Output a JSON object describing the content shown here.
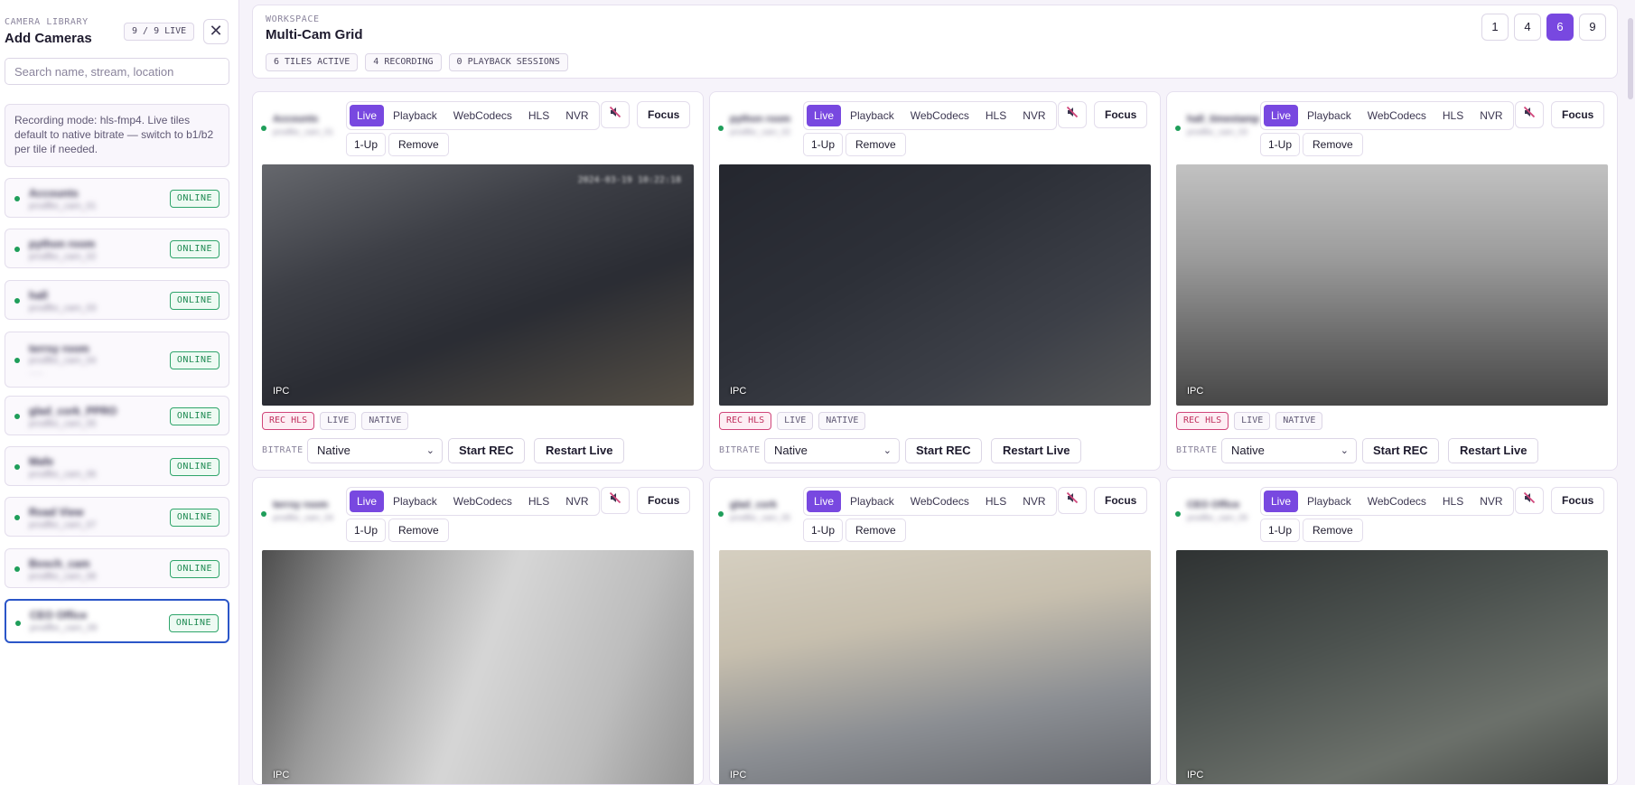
{
  "sidebar": {
    "kicker": "CAMERA LIBRARY",
    "title": "Add Cameras",
    "count": "9 / 9 LIVE",
    "close_icon": "close-icon",
    "search_placeholder": "Search name, stream, location",
    "note": "Recording mode: hls-fmp4. Live tiles default to native bitrate — switch to b1/b2 per tile if needed.",
    "cameras": [
      {
        "name": "Accounts",
        "sub": "prodfbc_cam_01",
        "status": "ONLINE"
      },
      {
        "name": "python room",
        "sub": "prodfbc_cam_02",
        "status": "ONLINE"
      },
      {
        "name": "hall",
        "sub": "prodfbc_cam_03",
        "status": "ONLINE"
      },
      {
        "name": "terrsy room",
        "sub": "prodfbc_cam_04",
        "status": "ONLINE"
      },
      {
        "name": "glad_cork_PPRO",
        "sub": "prodfbc_cam_05",
        "status": "ONLINE"
      },
      {
        "name": "Mafe",
        "sub": "prodfbc_cam_06",
        "status": "ONLINE"
      },
      {
        "name": "Road View",
        "sub": "prodfbc_cam_07",
        "status": "ONLINE"
      },
      {
        "name": "Bosch_cam",
        "sub": "prodfbc_cam_08",
        "status": "ONLINE"
      },
      {
        "name": "CEO Office",
        "sub": "prodfbc_cam_09",
        "status": "ONLINE"
      }
    ]
  },
  "header": {
    "kicker": "WORKSPACE",
    "title": "Multi-Cam Grid",
    "pills": [
      "6 TILES ACTIVE",
      "4 RECORDING",
      "0 PLAYBACK SESSIONS"
    ],
    "grid_options": [
      "1",
      "4",
      "6",
      "9"
    ],
    "grid_selected": "6"
  },
  "tile_controls": {
    "modes": [
      "Live",
      "Playback",
      "WebCodecs",
      "HLS",
      "NVR"
    ],
    "active_mode": "Live",
    "mute_icon": "speaker-off-icon",
    "focus": "Focus",
    "one_up": "1-Up",
    "remove": "Remove",
    "tags": [
      "REC HLS",
      "LIVE",
      "NATIVE"
    ],
    "bitrate_label": "BITRATE",
    "bitrate_value": "Native",
    "start_rec": "Start REC",
    "restart_live": "Restart Live",
    "video_label": "IPC"
  },
  "tiles": [
    {
      "name": "Accounts",
      "sub": "prodfbc_cam_01",
      "timestamp": "2024-03-19 10:22:18"
    },
    {
      "name": "python room",
      "sub": "prodfbc_cam_02",
      "timestamp": ""
    },
    {
      "name": "hall_timestamp",
      "sub": "prodfbc_cam_03",
      "timestamp": ""
    },
    {
      "name": "terrsy room",
      "sub": "prodfbc_cam_04",
      "timestamp": ""
    },
    {
      "name": "glad_cork",
      "sub": "prodfbc_cam_05",
      "timestamp": ""
    },
    {
      "name": "CEO Office",
      "sub": "prodfbc_cam_09",
      "timestamp": ""
    }
  ],
  "colors": {
    "accent": "#7848e0",
    "online": "#1e8a52",
    "rec": "#c0325f",
    "selected_border": "#2b56c8"
  }
}
